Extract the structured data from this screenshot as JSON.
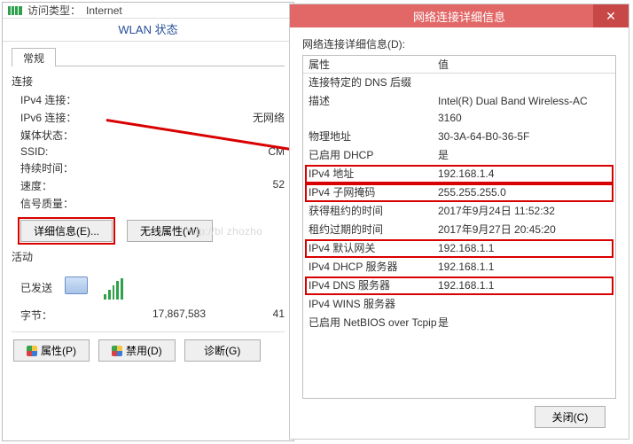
{
  "wlan": {
    "access_type_label": "访问类型：",
    "access_type_value": "Internet",
    "window_title": "WLAN 状态",
    "tab_general": "常规",
    "section_connection": "连接",
    "rows": {
      "ipv4_label": "IPv4 连接：",
      "ipv4_value": "",
      "ipv6_label": "IPv6 连接：",
      "ipv6_value": "无网络",
      "media_label": "媒体状态：",
      "media_value": "",
      "ssid_label": "SSID:",
      "ssid_value": "CM",
      "duration_label": "持续时间：",
      "duration_value": "",
      "speed_label": "速度：",
      "speed_value": "52",
      "signal_label": "信号质量：",
      "signal_value": ""
    },
    "btn_details": "详细信息(E)...",
    "btn_wireless": "无线属性(W)",
    "section_activity": "活动",
    "activity_sent_label": "已发送",
    "bytes_label": "字节：",
    "bytes_sent": "17,867,583",
    "bytes_recv": "41",
    "btn_props": "属性(P)",
    "btn_disable": "禁用(D)",
    "btn_diag": "诊断(G)"
  },
  "watermark": "http://bl                    zhozho",
  "details": {
    "title": "网络连接详细信息",
    "list_label": "网络连接详细信息(D):",
    "col_property": "属性",
    "col_value": "值",
    "rows": [
      {
        "p": "连接特定的 DNS 后缀",
        "v": "",
        "box": false
      },
      {
        "p": "描述",
        "v": "Intel(R) Dual Band Wireless-AC 3160",
        "box": false
      },
      {
        "p": "物理地址",
        "v": "30-3A-64-B0-36-5F",
        "box": false
      },
      {
        "p": "已启用 DHCP",
        "v": "是",
        "box": false
      },
      {
        "p": "IPv4 地址",
        "v": "192.168.1.4",
        "box": true
      },
      {
        "p": "IPv4 子网掩码",
        "v": "255.255.255.0",
        "box": true
      },
      {
        "p": "获得租约的时间",
        "v": "2017年9月24日 11:52:32",
        "box": false
      },
      {
        "p": "租约过期的时间",
        "v": "2017年9月27日 20:45:20",
        "box": false
      },
      {
        "p": "IPv4 默认网关",
        "v": "192.168.1.1",
        "box": true
      },
      {
        "p": "IPv4 DHCP 服务器",
        "v": "192.168.1.1",
        "box": false
      },
      {
        "p": "IPv4 DNS 服务器",
        "v": "192.168.1.1",
        "box": true
      },
      {
        "p": "IPv4 WINS 服务器",
        "v": "",
        "box": false
      },
      {
        "p": "已启用 NetBIOS over Tcpip",
        "v": "是",
        "box": false
      }
    ],
    "btn_close": "关闭(C)"
  }
}
